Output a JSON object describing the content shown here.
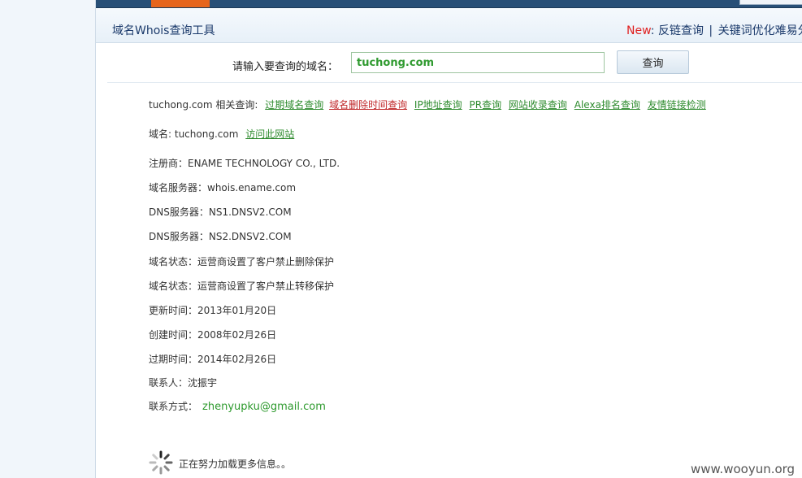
{
  "header": {
    "tool_title": "域名Whois查询工具",
    "new_label": "New",
    "new_colon": ":",
    "links": [
      "反链查询",
      "关键词优化难易分"
    ],
    "separator": "|"
  },
  "search": {
    "label": "请输入要查询的域名：",
    "value": "tuchong.com",
    "button_label": "查询"
  },
  "related": {
    "prefix": "tuchong.com 相关查询:",
    "links": [
      "过期域名查询",
      "域名删除时间查询",
      "IP地址查询",
      "PR查询",
      "网站收录查询",
      "Alexa排名查询",
      "友情链接检测"
    ]
  },
  "domain_line": {
    "label": "域名:",
    "value": "tuchong.com",
    "visit_link": "访问此网站"
  },
  "whois": [
    {
      "label": "注册商：",
      "value": "ENAME TECHNOLOGY CO., LTD."
    },
    {
      "label": "域名服务器：",
      "value": "whois.ename.com"
    },
    {
      "label": "DNS服务器：",
      "value": "NS1.DNSV2.COM"
    },
    {
      "label": "DNS服务器：",
      "value": "NS2.DNSV2.COM"
    },
    {
      "label": "域名状态：",
      "value": "运营商设置了客户禁止删除保护"
    },
    {
      "label": "域名状态：",
      "value": "运营商设置了客户禁止转移保护"
    },
    {
      "label": "更新时间：",
      "value": "2013年01月20日"
    },
    {
      "label": "创建时间：",
      "value": "2008年02月26日"
    },
    {
      "label": "过期时间：",
      "value": "2014年02月26日"
    },
    {
      "label": "联系人：",
      "value": "沈振宇"
    },
    {
      "label": "联系方式：",
      "value": "zhenyupku@gmail.com"
    }
  ],
  "loading_text": "正在努力加载更多信息。。",
  "watermark": "www.wooyun.org",
  "colors": {
    "link_green": "#2e8b2e",
    "link_red": "#c0282a",
    "title_blue": "#1b3a6b",
    "new_red": "#e02020",
    "top_bar": "#274f77",
    "active_tab": "#e6651c"
  }
}
